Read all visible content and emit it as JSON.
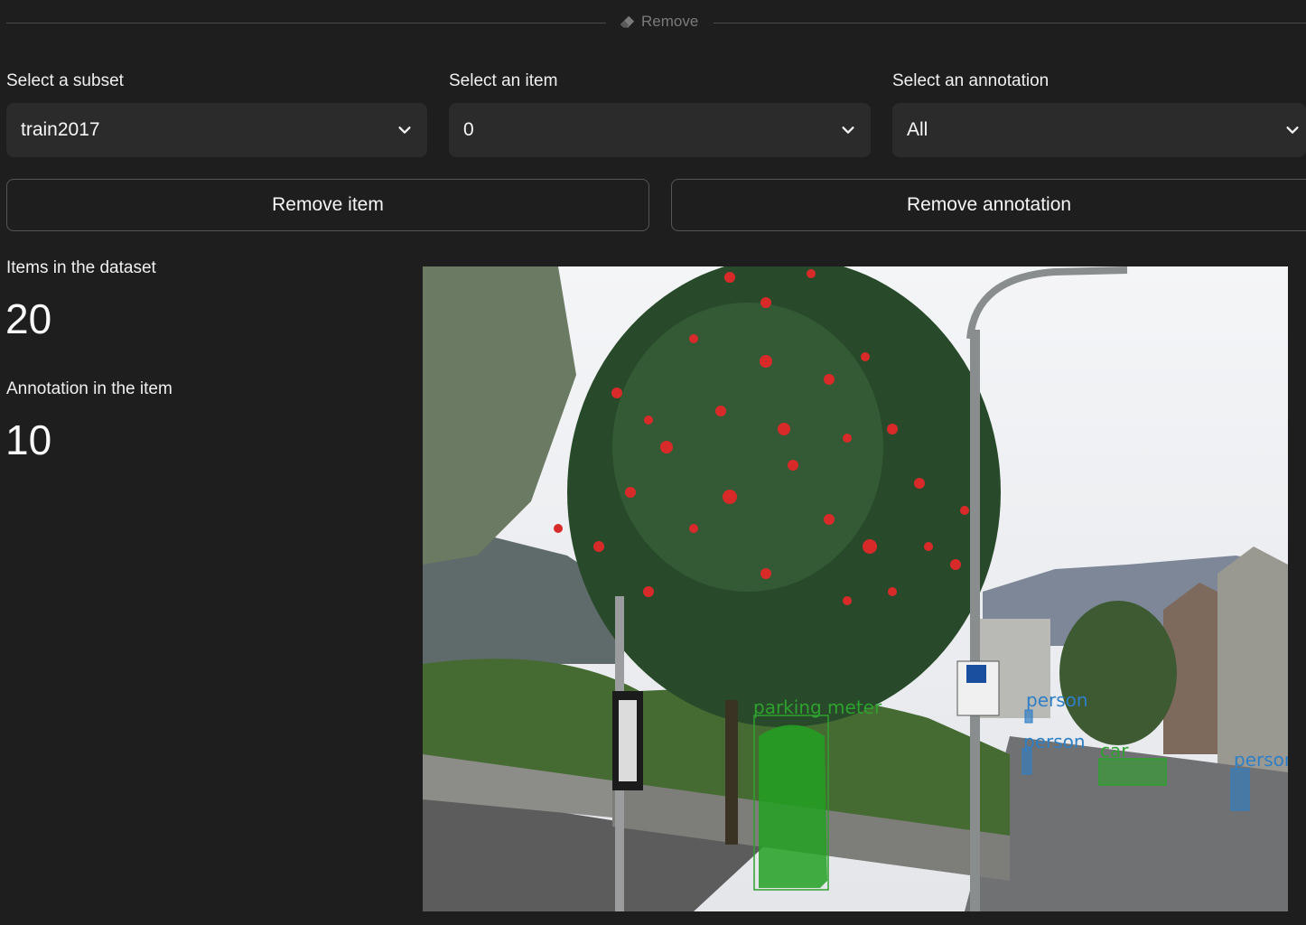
{
  "section": {
    "title": "Remove",
    "icon": "eraser-icon"
  },
  "subset": {
    "label": "Select a subset",
    "value": "train2017",
    "icon": "chevron-down-icon"
  },
  "item": {
    "label": "Select an item",
    "value": "0",
    "icon": "chevron-down-icon"
  },
  "annotation": {
    "label": "Select an annotation",
    "value": "All",
    "icon": "chevron-down-icon"
  },
  "buttons": {
    "remove_item": "Remove item",
    "remove_annotation": "Remove annotation"
  },
  "stats": {
    "items_label": "Items in the dataset",
    "items_value": "20",
    "annotations_label": "Annotation in the item",
    "annotations_value": "10"
  },
  "image": {
    "annotations": [
      {
        "label": "parking meter",
        "color": "#2ea12e"
      },
      {
        "label": "person",
        "color": "#2f7fc6"
      },
      {
        "label": "person",
        "color": "#2f7fc6"
      },
      {
        "label": "car",
        "color": "#2ea12e"
      },
      {
        "label": "person",
        "color": "#2f7fc6"
      }
    ]
  },
  "colors": {
    "background": "#1e1e1e",
    "select_bg": "#2b2b2b",
    "border": "#555555"
  }
}
